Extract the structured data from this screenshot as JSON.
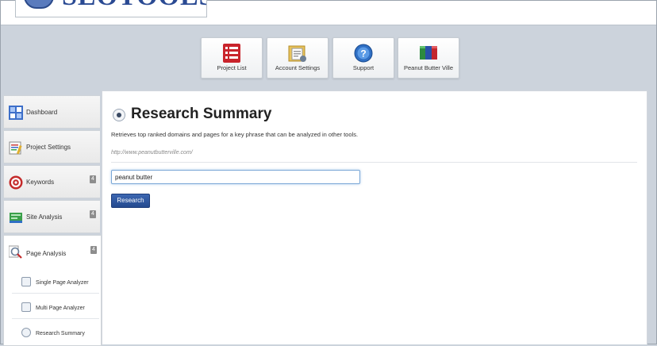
{
  "header": {
    "logo_text": "SEOTOOLSET"
  },
  "toolbar": {
    "tiles": [
      {
        "label": "Project List",
        "icon": "list-icon"
      },
      {
        "label": "Account Settings",
        "icon": "folder-settings-icon"
      },
      {
        "label": "Support",
        "icon": "help-icon"
      },
      {
        "label": "Peanut Butter Ville",
        "icon": "project-cubes-icon"
      }
    ]
  },
  "sidebar": {
    "items": [
      {
        "label": "Dashboard",
        "badge": ""
      },
      {
        "label": "Project Settings",
        "badge": ""
      },
      {
        "label": "Keywords",
        "badge": "4"
      },
      {
        "label": "Site Analysis",
        "badge": "4"
      },
      {
        "label": "Page Analysis",
        "badge": "4"
      }
    ],
    "sub_items": [
      {
        "label": "Single Page Analyzer"
      },
      {
        "label": "Multi Page Analyzer"
      },
      {
        "label": "Research Summary"
      }
    ]
  },
  "main": {
    "title": "Research Summary",
    "description": "Retrieves top ranked domains and pages for a key phrase that can be analyzed in other tools.",
    "url": "http://www.peanutbutterville.com/",
    "search_value": "peanut butter",
    "button_label": "Research"
  },
  "colors": {
    "accent": "#2a4f99",
    "background": "#ccd3dc"
  }
}
